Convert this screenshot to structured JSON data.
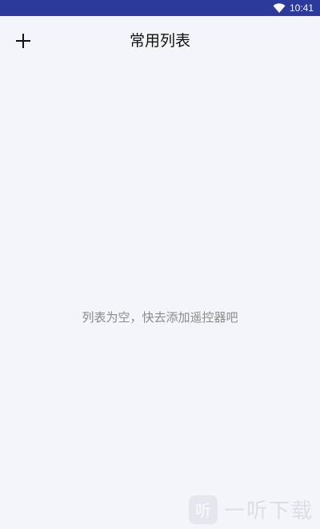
{
  "status_bar": {
    "time": "10:41",
    "wifi_icon": "wifi-icon",
    "background_color": "#2c3a9c"
  },
  "app_bar": {
    "title": "常用列表",
    "add_icon": "plus-icon"
  },
  "main": {
    "empty_message": "列表为空，快去添加遥控器吧"
  },
  "watermark": {
    "logo_text": "听",
    "text": "一听下载"
  },
  "colors": {
    "background": "#f4f5fa",
    "text_primary": "#111111",
    "text_secondary": "#8a8a8a"
  }
}
